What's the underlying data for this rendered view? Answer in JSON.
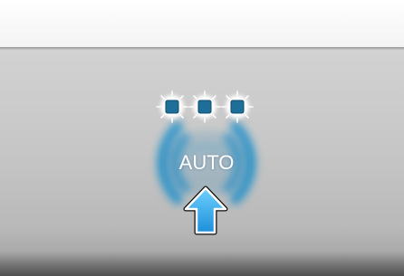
{
  "button": {
    "label": "AUTO",
    "state": "active",
    "indicator_count": 3
  },
  "icons": {
    "indicators": "status-lights-icon",
    "glow": "signal-waves-icon",
    "pointer": "press-arrow-icon"
  },
  "colors": {
    "glow": "#1f8fc9",
    "indicator": "#1d6f99",
    "arrow": "#2aa6e6",
    "panel": "#c8c8c8",
    "label": "#ffffff"
  }
}
